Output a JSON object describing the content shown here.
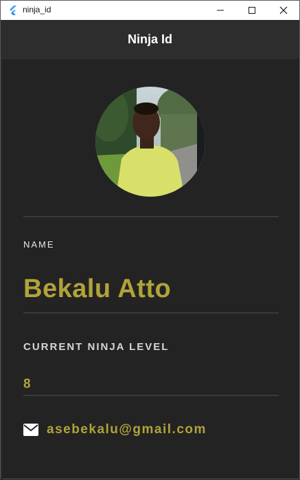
{
  "window": {
    "title": "ninja_id",
    "controls": {
      "minimize_icon": "minimize-icon",
      "maximize_icon": "maximize-icon",
      "close_icon": "close-icon"
    }
  },
  "appbar": {
    "title": "Ninja Id"
  },
  "profile": {
    "avatar_icon": "profile-photo",
    "name_label": "NAME",
    "name": "Bekalu Atto",
    "level_label": "CURRENT NINJA LEVEL",
    "level": "8",
    "email_icon": "mail-icon",
    "email": "asebekalu@gmail.com"
  },
  "colors": {
    "background": "#232323",
    "appbar": "#2d2d2d",
    "accent": "#b0a33a",
    "label": "#e8e8e8",
    "divider": "#3a3a3a"
  }
}
